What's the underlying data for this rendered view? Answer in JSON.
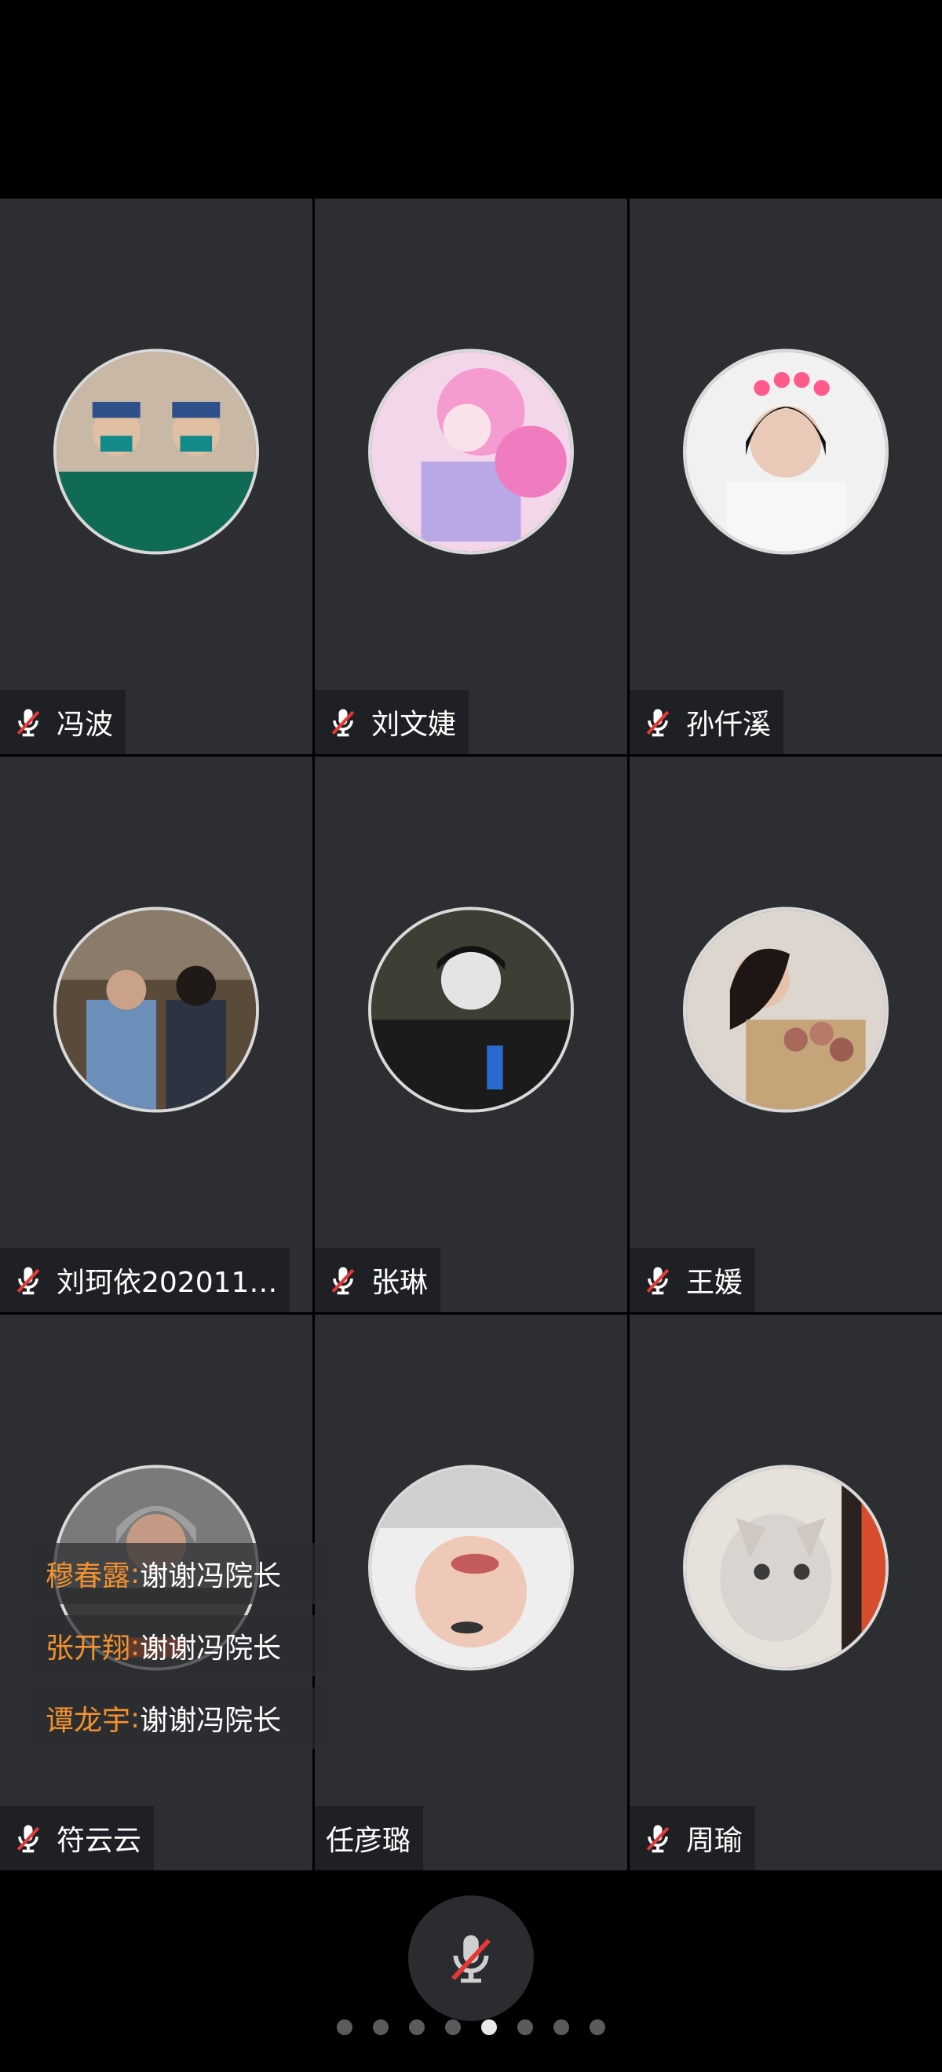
{
  "participants": [
    {
      "name": "冯波",
      "muted": true
    },
    {
      "name": "刘文婕",
      "muted": true
    },
    {
      "name": "孙仟溪",
      "muted": true
    },
    {
      "name": "刘珂依202011…",
      "muted": true
    },
    {
      "name": "张琳",
      "muted": true
    },
    {
      "name": "王媛",
      "muted": true
    },
    {
      "name": "符云云",
      "muted": true
    },
    {
      "name": "任彦璐",
      "muted": false
    },
    {
      "name": "周瑜",
      "muted": true
    }
  ],
  "chat": [
    {
      "sender": "穆春露",
      "colon": ":",
      "message": " 谢谢冯院长"
    },
    {
      "sender": "张开翔",
      "colon": ":",
      "message": " 谢谢冯院长"
    },
    {
      "sender": "谭龙宇",
      "colon": ":",
      "message": " 谢谢冯院长"
    }
  ],
  "pager": {
    "total": 8,
    "active_index": 4
  },
  "colors": {
    "tile_bg": "#2d2e31",
    "chat_sender": "#f2912e",
    "mute_slash": "#e53935"
  }
}
